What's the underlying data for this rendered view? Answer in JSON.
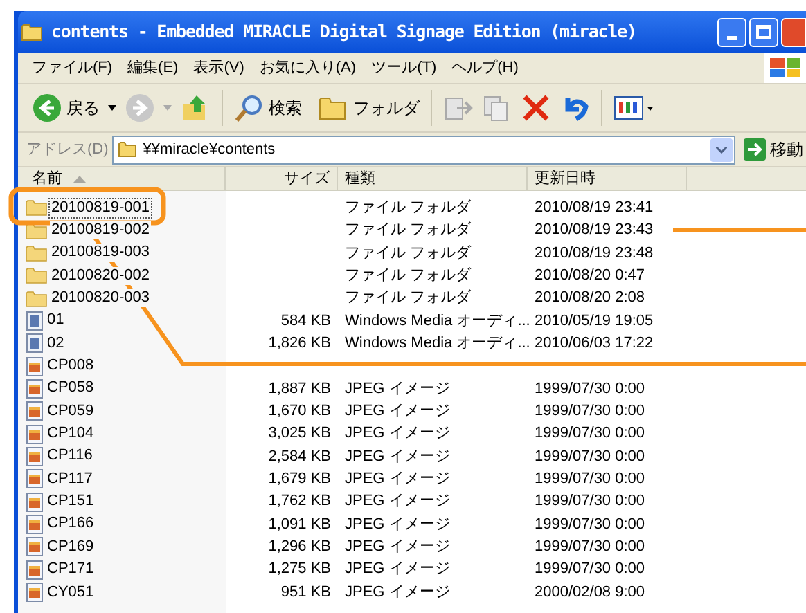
{
  "window": {
    "title": "contents - Embedded MIRACLE Digital Signage Edition (miracle)"
  },
  "menu": [
    "ファイル(F)",
    "編集(E)",
    "表示(V)",
    "お気に入り(A)",
    "ツール(T)",
    "ヘルプ(H)"
  ],
  "toolbar": {
    "back": "戻る",
    "search": "検索",
    "folders": "フォルダ"
  },
  "address": {
    "label": "アドレス(D)",
    "value": "¥¥miracle¥contents",
    "go": "移動"
  },
  "columns": [
    "名前",
    "サイズ",
    "種類",
    "更新日時"
  ],
  "rows": [
    {
      "kind": "folder",
      "name": "20100819-001",
      "size": "",
      "type": "ファイル フォルダ",
      "date": "2010/08/19 23:41",
      "focused": true
    },
    {
      "kind": "folder",
      "name": "20100819-002",
      "size": "",
      "type": "ファイル フォルダ",
      "date": "2010/08/19 23:43",
      "focused": false
    },
    {
      "kind": "folder",
      "name": "20100819-003",
      "size": "",
      "type": "ファイル フォルダ",
      "date": "2010/08/19 23:48",
      "focused": false
    },
    {
      "kind": "folder",
      "name": "20100820-002",
      "size": "",
      "type": "ファイル フォルダ",
      "date": "2010/08/20 0:47",
      "focused": false
    },
    {
      "kind": "folder",
      "name": "20100820-003",
      "size": "",
      "type": "ファイル フォルダ",
      "date": "2010/08/20 2:08",
      "focused": false
    },
    {
      "kind": "audio",
      "name": "01",
      "size": "584 KB",
      "type": "Windows Media オーディ...",
      "date": "2010/05/19 19:05",
      "focused": false
    },
    {
      "kind": "audio",
      "name": "02",
      "size": "1,826 KB",
      "type": "Windows Media オーディ...",
      "date": "2010/06/03 17:22",
      "focused": false
    },
    {
      "kind": "image",
      "name": "CP008",
      "size": "",
      "type": "",
      "date": "",
      "focused": false
    },
    {
      "kind": "image",
      "name": "CP058",
      "size": "1,887 KB",
      "type": "JPEG イメージ",
      "date": "1999/07/30 0:00",
      "focused": false
    },
    {
      "kind": "image",
      "name": "CP059",
      "size": "1,670 KB",
      "type": "JPEG イメージ",
      "date": "1999/07/30 0:00",
      "focused": false
    },
    {
      "kind": "image",
      "name": "CP104",
      "size": "3,025 KB",
      "type": "JPEG イメージ",
      "date": "1999/07/30 0:00",
      "focused": false
    },
    {
      "kind": "image",
      "name": "CP116",
      "size": "2,584 KB",
      "type": "JPEG イメージ",
      "date": "1999/07/30 0:00",
      "focused": false
    },
    {
      "kind": "image",
      "name": "CP117",
      "size": "1,679 KB",
      "type": "JPEG イメージ",
      "date": "1999/07/30 0:00",
      "focused": false
    },
    {
      "kind": "image",
      "name": "CP151",
      "size": "1,762 KB",
      "type": "JPEG イメージ",
      "date": "1999/07/30 0:00",
      "focused": false
    },
    {
      "kind": "image",
      "name": "CP166",
      "size": "1,091 KB",
      "type": "JPEG イメージ",
      "date": "1999/07/30 0:00",
      "focused": false
    },
    {
      "kind": "image",
      "name": "CP169",
      "size": "1,296 KB",
      "type": "JPEG イメージ",
      "date": "1999/07/30 0:00",
      "focused": false
    },
    {
      "kind": "image",
      "name": "CP171",
      "size": "1,275 KB",
      "type": "JPEG イメージ",
      "date": "1999/07/30 0:00",
      "focused": false
    },
    {
      "kind": "image",
      "name": "CY051",
      "size": "951 KB",
      "type": "JPEG イメージ",
      "date": "2000/02/08 9:00",
      "focused": false
    }
  ]
}
